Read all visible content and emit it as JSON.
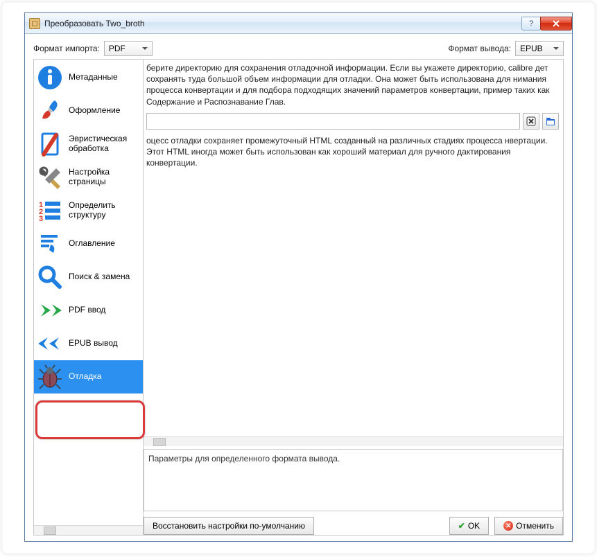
{
  "window": {
    "title": "Преобразовать Two_broth"
  },
  "toprow": {
    "import_label": "Формат импорта:",
    "import_value": "PDF",
    "output_label": "Формат вывода:",
    "output_value": "EPUB"
  },
  "sidebar": {
    "items": [
      {
        "label": "Метаданные"
      },
      {
        "label": "Оформление"
      },
      {
        "label": "Эвристическая обработка"
      },
      {
        "label": "Настройка страницы"
      },
      {
        "label": "Определить структуру"
      },
      {
        "label": "Оглавление"
      },
      {
        "label": "Поиск & замена"
      },
      {
        "label": "PDF ввод"
      },
      {
        "label": "EPUB вывод"
      },
      {
        "label": "Отладка"
      }
    ]
  },
  "main": {
    "para1": "берите директорию для сохранения отладочной информации. Если вы укажете директорию, calibre дет сохранять туда большой объем информации для отладки. Она может быть использована для нимания процесса конвертации и для подбора подходящих значений параметров конвертации, пример таких как Содержание и Распознавание Глав.",
    "path_value": "",
    "para2": "оцесс отладки сохраняет промежуточный HTML созданный на различных стадиях процесса нвертации. Этот HTML иногда может быть использован как хороший материал для ручного дактирования конвертации.",
    "descbox": "Параметры для определенного формата вывода."
  },
  "buttons": {
    "restore": "Восстановить настройки по-умолчанию",
    "ok": "OK",
    "cancel": "Отменить"
  }
}
